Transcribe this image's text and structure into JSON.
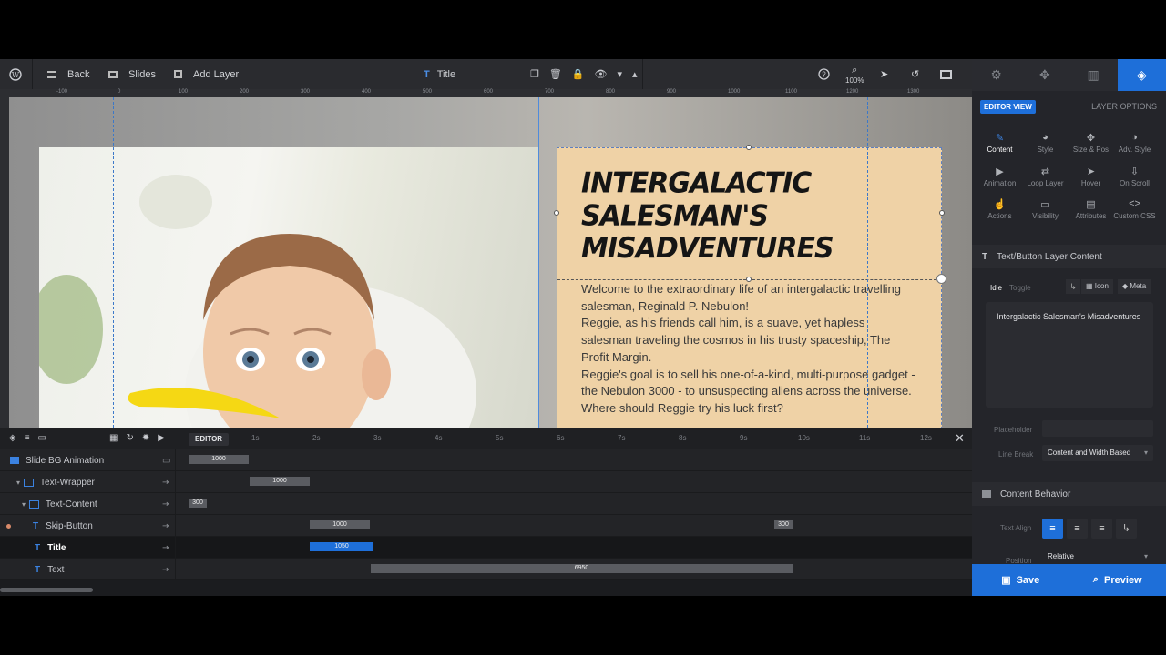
{
  "toolbar": {
    "back": "Back",
    "slides": "Slides",
    "add_layer": "Add Layer",
    "layer_name": "Title",
    "zoom": "100%"
  },
  "ruler_ticks": [
    "-100",
    "0",
    "100",
    "200",
    "300",
    "400",
    "500",
    "600",
    "700",
    "800",
    "900",
    "1000",
    "1100",
    "1200",
    "1300"
  ],
  "canvas": {
    "title": "INTERGALACTIC SALESMAN'S MISADVENTURES",
    "body": [
      "Welcome to the extraordinary life of an intergalactic travelling salesman, Reginald P. Nebulon!",
      "Reggie, as his friends call him, is a suave, yet hapless salesman traveling the cosmos in his trusty spaceship, The Profit Margin.",
      "Reggie's goal is to sell his one-of-a-kind, multi-purpose gadget - the Nebulon 3000 - to unsuspecting aliens across the universe.",
      "Where should Reggie try his luck first?"
    ]
  },
  "timeline": {
    "editor_label": "EDITOR",
    "seconds": [
      "1s",
      "2s",
      "3s",
      "4s",
      "5s",
      "6s",
      "7s",
      "8s",
      "9s",
      "10s",
      "11s",
      "12s"
    ],
    "rows": [
      {
        "label": "Slide BG Animation",
        "bar": "1000",
        "bar2": ""
      },
      {
        "label": "Text-Wrapper",
        "bar": "1000",
        "bar2": ""
      },
      {
        "label": "Text-Content",
        "bar": "300",
        "bar2": ""
      },
      {
        "label": "Skip-Button",
        "bar": "1000",
        "bar2": "300"
      },
      {
        "label": "Title",
        "bar": "1050",
        "bar2": ""
      },
      {
        "label": "Text",
        "bar": "6950",
        "bar2": ""
      }
    ]
  },
  "panel": {
    "editor_view": "EDITOR VIEW",
    "layer_options": "LAYER OPTIONS",
    "items": [
      "Content",
      "Style",
      "Size & Pos",
      "Adv. Style",
      "Animation",
      "Loop Layer",
      "Hover",
      "On Scroll",
      "Actions",
      "Visibility",
      "Attributes",
      "Custom CSS"
    ],
    "section_content": "Text/Button Layer Content",
    "idle": "Idle",
    "toggle": "Toggle",
    "icon": "Icon",
    "meta": "Meta",
    "text_value": "Intergalactic Salesman's Misadventures",
    "placeholder_label": "Placeholder",
    "line_break_label": "Line Break",
    "line_break_value": "Content and Width Based",
    "section_behavior": "Content Behavior",
    "text_align_label": "Text Align",
    "position_label": "Position",
    "position_value": "Relative",
    "save": "Save",
    "preview": "Preview"
  },
  "colors": {
    "accent": "#1e6fd9",
    "text_box_bg": "#efd2a6"
  }
}
